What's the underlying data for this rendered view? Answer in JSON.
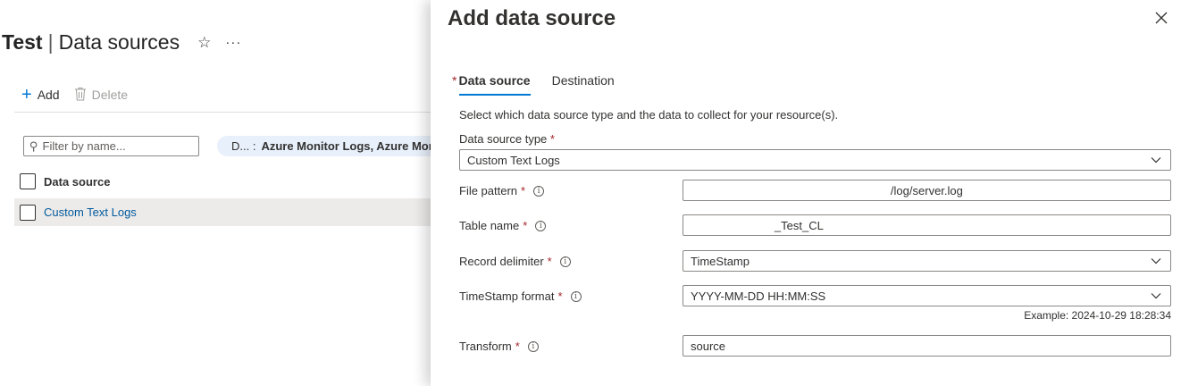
{
  "page": {
    "title_bold": "Test",
    "title_sep": "|",
    "title_rest": "Data sources",
    "star_icon": "star-icon",
    "more_icon": "more-icon"
  },
  "toolbar": {
    "add_label": "Add",
    "delete_label": "Delete"
  },
  "filter": {
    "placeholder": "Filter by name...",
    "pill_key": "D... :",
    "pill_value": "Azure Monitor Logs, Azure Mon"
  },
  "grid": {
    "header": "Data source",
    "rows": [
      {
        "label": "Custom Text Logs"
      }
    ]
  },
  "blade": {
    "title": "Add data source",
    "tabs": [
      {
        "label": "Data source",
        "required": "*",
        "active": true
      },
      {
        "label": "Destination",
        "active": false
      }
    ],
    "description": "Select which data source type and the data to collect for your resource(s).",
    "data_source_type": {
      "label": "Data source type",
      "required": "*",
      "value": "Custom Text Logs"
    },
    "fields": {
      "file_pattern": {
        "label": "File pattern",
        "required": "*",
        "value": "                                                              /log/server.log"
      },
      "table_name": {
        "label": "Table name",
        "required": "*",
        "value": "                          _Test_CL"
      },
      "record_delimiter": {
        "label": "Record delimiter",
        "required": "*",
        "value": "TimeStamp"
      },
      "timestamp_format": {
        "label": "TimeStamp format",
        "required": "*",
        "value": "YYYY-MM-DD HH:MM:SS",
        "example": "Example: 2024-10-29 18:28:34"
      },
      "transform": {
        "label": "Transform",
        "required": "*",
        "value": "source"
      }
    }
  }
}
